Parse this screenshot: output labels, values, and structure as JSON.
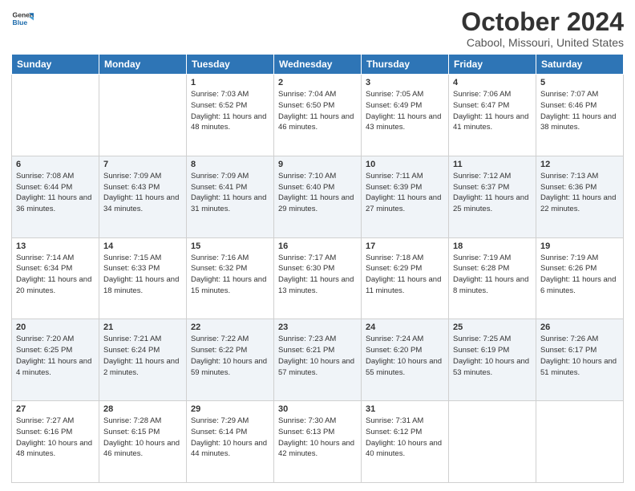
{
  "header": {
    "logo_line1": "General",
    "logo_line2": "Blue",
    "title": "October 2024",
    "subtitle": "Cabool, Missouri, United States"
  },
  "days_of_week": [
    "Sunday",
    "Monday",
    "Tuesday",
    "Wednesday",
    "Thursday",
    "Friday",
    "Saturday"
  ],
  "weeks": [
    [
      {
        "day": "",
        "info": ""
      },
      {
        "day": "",
        "info": ""
      },
      {
        "day": "1",
        "info": "Sunrise: 7:03 AM\nSunset: 6:52 PM\nDaylight: 11 hours and 48 minutes."
      },
      {
        "day": "2",
        "info": "Sunrise: 7:04 AM\nSunset: 6:50 PM\nDaylight: 11 hours and 46 minutes."
      },
      {
        "day": "3",
        "info": "Sunrise: 7:05 AM\nSunset: 6:49 PM\nDaylight: 11 hours and 43 minutes."
      },
      {
        "day": "4",
        "info": "Sunrise: 7:06 AM\nSunset: 6:47 PM\nDaylight: 11 hours and 41 minutes."
      },
      {
        "day": "5",
        "info": "Sunrise: 7:07 AM\nSunset: 6:46 PM\nDaylight: 11 hours and 38 minutes."
      }
    ],
    [
      {
        "day": "6",
        "info": "Sunrise: 7:08 AM\nSunset: 6:44 PM\nDaylight: 11 hours and 36 minutes."
      },
      {
        "day": "7",
        "info": "Sunrise: 7:09 AM\nSunset: 6:43 PM\nDaylight: 11 hours and 34 minutes."
      },
      {
        "day": "8",
        "info": "Sunrise: 7:09 AM\nSunset: 6:41 PM\nDaylight: 11 hours and 31 minutes."
      },
      {
        "day": "9",
        "info": "Sunrise: 7:10 AM\nSunset: 6:40 PM\nDaylight: 11 hours and 29 minutes."
      },
      {
        "day": "10",
        "info": "Sunrise: 7:11 AM\nSunset: 6:39 PM\nDaylight: 11 hours and 27 minutes."
      },
      {
        "day": "11",
        "info": "Sunrise: 7:12 AM\nSunset: 6:37 PM\nDaylight: 11 hours and 25 minutes."
      },
      {
        "day": "12",
        "info": "Sunrise: 7:13 AM\nSunset: 6:36 PM\nDaylight: 11 hours and 22 minutes."
      }
    ],
    [
      {
        "day": "13",
        "info": "Sunrise: 7:14 AM\nSunset: 6:34 PM\nDaylight: 11 hours and 20 minutes."
      },
      {
        "day": "14",
        "info": "Sunrise: 7:15 AM\nSunset: 6:33 PM\nDaylight: 11 hours and 18 minutes."
      },
      {
        "day": "15",
        "info": "Sunrise: 7:16 AM\nSunset: 6:32 PM\nDaylight: 11 hours and 15 minutes."
      },
      {
        "day": "16",
        "info": "Sunrise: 7:17 AM\nSunset: 6:30 PM\nDaylight: 11 hours and 13 minutes."
      },
      {
        "day": "17",
        "info": "Sunrise: 7:18 AM\nSunset: 6:29 PM\nDaylight: 11 hours and 11 minutes."
      },
      {
        "day": "18",
        "info": "Sunrise: 7:19 AM\nSunset: 6:28 PM\nDaylight: 11 hours and 8 minutes."
      },
      {
        "day": "19",
        "info": "Sunrise: 7:19 AM\nSunset: 6:26 PM\nDaylight: 11 hours and 6 minutes."
      }
    ],
    [
      {
        "day": "20",
        "info": "Sunrise: 7:20 AM\nSunset: 6:25 PM\nDaylight: 11 hours and 4 minutes."
      },
      {
        "day": "21",
        "info": "Sunrise: 7:21 AM\nSunset: 6:24 PM\nDaylight: 11 hours and 2 minutes."
      },
      {
        "day": "22",
        "info": "Sunrise: 7:22 AM\nSunset: 6:22 PM\nDaylight: 10 hours and 59 minutes."
      },
      {
        "day": "23",
        "info": "Sunrise: 7:23 AM\nSunset: 6:21 PM\nDaylight: 10 hours and 57 minutes."
      },
      {
        "day": "24",
        "info": "Sunrise: 7:24 AM\nSunset: 6:20 PM\nDaylight: 10 hours and 55 minutes."
      },
      {
        "day": "25",
        "info": "Sunrise: 7:25 AM\nSunset: 6:19 PM\nDaylight: 10 hours and 53 minutes."
      },
      {
        "day": "26",
        "info": "Sunrise: 7:26 AM\nSunset: 6:17 PM\nDaylight: 10 hours and 51 minutes."
      }
    ],
    [
      {
        "day": "27",
        "info": "Sunrise: 7:27 AM\nSunset: 6:16 PM\nDaylight: 10 hours and 48 minutes."
      },
      {
        "day": "28",
        "info": "Sunrise: 7:28 AM\nSunset: 6:15 PM\nDaylight: 10 hours and 46 minutes."
      },
      {
        "day": "29",
        "info": "Sunrise: 7:29 AM\nSunset: 6:14 PM\nDaylight: 10 hours and 44 minutes."
      },
      {
        "day": "30",
        "info": "Sunrise: 7:30 AM\nSunset: 6:13 PM\nDaylight: 10 hours and 42 minutes."
      },
      {
        "day": "31",
        "info": "Sunrise: 7:31 AM\nSunset: 6:12 PM\nDaylight: 10 hours and 40 minutes."
      },
      {
        "day": "",
        "info": ""
      },
      {
        "day": "",
        "info": ""
      }
    ]
  ]
}
